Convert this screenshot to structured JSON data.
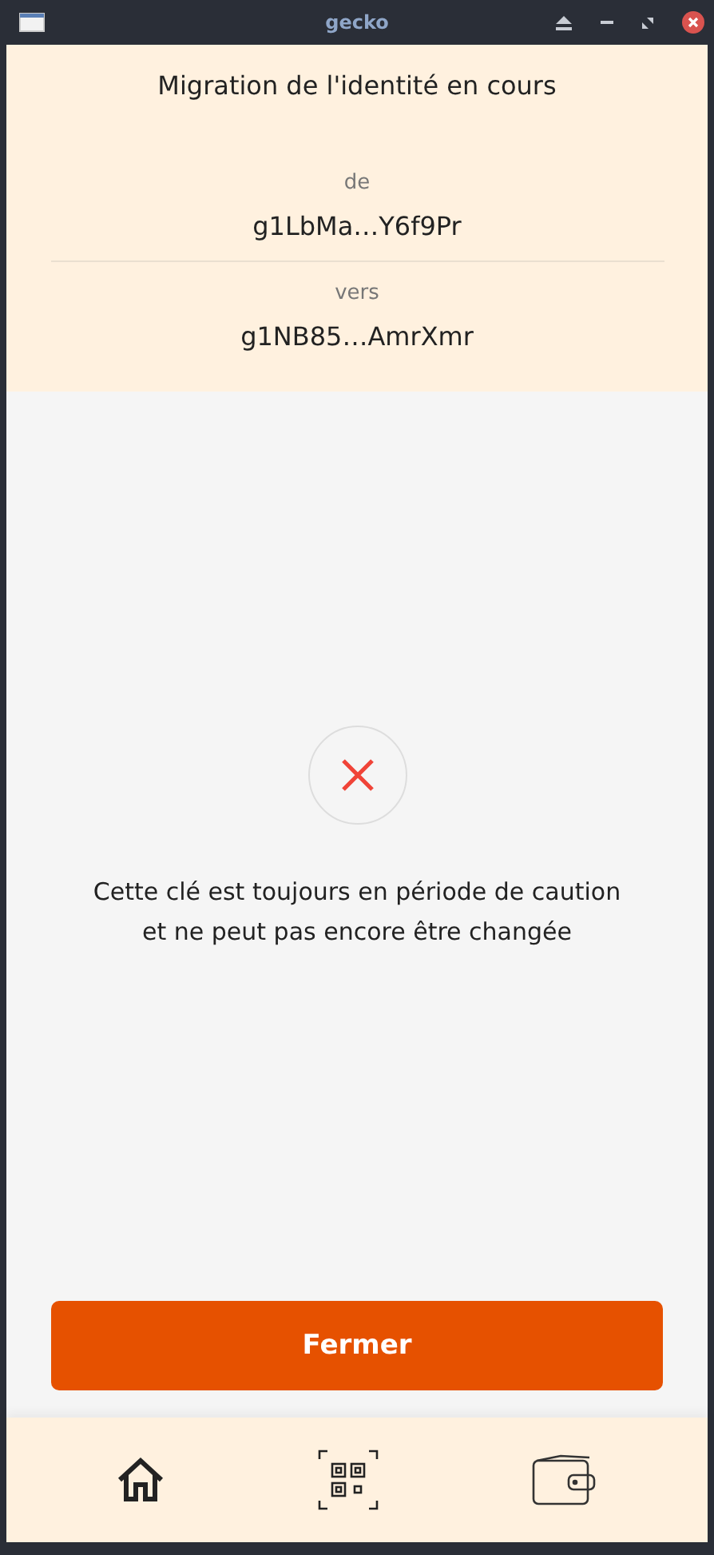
{
  "window": {
    "title": "gecko"
  },
  "header": {
    "title": "Migration de l'identité en cours",
    "from_label": "de",
    "from_address": "g1LbMa…Y6f9Pr",
    "to_label": "vers",
    "to_address": "g1NB85…AmrXmr"
  },
  "message": {
    "lines": [
      "Cette clé est toujours en période de caution",
      "et ne peut pas encore être changée"
    ]
  },
  "close_button": {
    "label": "Fermer"
  }
}
